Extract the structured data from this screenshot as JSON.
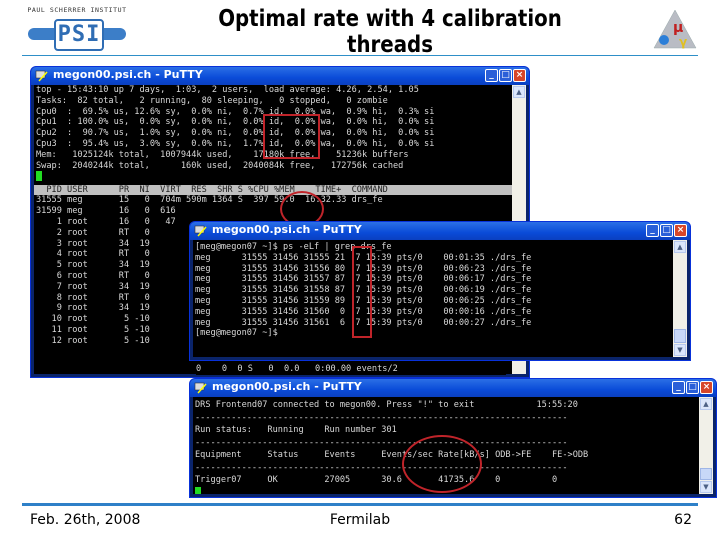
{
  "slide": {
    "title": "Optimal rate with 4 calibration threads",
    "logo_left": {
      "org": "PAUL SCHERRER INSTITUT",
      "mark": "PSI"
    },
    "logo_right": {
      "symbols": [
        "μ",
        "e",
        "γ"
      ]
    },
    "footer": {
      "date": "Feb. 26th, 2008",
      "venue": "Fermilab",
      "page": "62"
    },
    "colors": {
      "rule": "#2e8fc8",
      "highlight": "#c0242a",
      "terminal_bg": "#000000",
      "titlebar": "#0a4bd8",
      "cursor": "#22dd22"
    }
  },
  "windows": [
    {
      "id": "top",
      "title": "megon00.psi.ch - PuTTY",
      "lines": [
        "top - 15:43:10 up 7 days,  1:03,  2 users,  load average: 4.26, 2.54, 1.05",
        "Tasks:  82 total,   2 running,  80 sleeping,   0 stopped,   0 zombie",
        "Cpu0  :  69.5% us, 12.6% sy,  0.0% ni,  0.7% id,  0.0% wa,  0.9% hi,  0.3% si",
        "Cpu1  : 100.0% us,  0.0% sy,  0.0% ni,  0.0% id,  0.0% wa,  0.0% hi,  0.0% si",
        "Cpu2  :  90.7% us,  1.0% sy,  0.0% ni,  0.0% id,  0.0% wa,  0.0% hi,  0.0% si",
        "Cpu3  :  95.4% us,  3.0% sy,  0.0% ni,  1.7% id,  0.0% wa,  0.0% hi,  0.0% si",
        "Mem:   1025124k total,  1007944k used,    17180k free,    51236k buffers",
        "Swap:  2040244k total,      160k used,  2040084k free,   172756k cached"
      ],
      "process_header": "  PID USER      PR  NI  VIRT  RES  SHR S %CPU %MEM    TIME+  COMMAND",
      "processes": [
        "31555 meg       15   0  704m 590m 1364 S  397 59.0  16:32.33 drs_fe",
        "31599 meg       16   0  616",
        "    1 root      16   0   47",
        "    2 root      RT   0",
        "    3 root      34  19",
        "    4 root      RT   0",
        "    5 root      34  19",
        "    6 root      RT   0",
        "    7 root      34  19",
        "    8 root      RT   0",
        "    9 root      34  19",
        "   10 root       5 -10",
        "   11 root       5 -10",
        "   12 root       5 -10"
      ],
      "partial_row_tail": "0    0  0 S   0  0.0   0:00.00 events/2",
      "highlight_note": "%CPU 397"
    },
    {
      "id": "ps",
      "title": "megon00.psi.ch - PuTTY",
      "lines": [
        "[meg@megon07 ~]$ ps -eLf | grep drs_fe",
        "meg      31555 31456 31555 21  7 15:39 pts/0    00:01:35 ./drs_fe",
        "meg      31555 31456 31556 80  7 15:39 pts/0    00:06:23 ./drs_fe",
        "meg      31555 31456 31557 87  7 15:39 pts/0    00:06:17 ./drs_fe",
        "meg      31555 31456 31558 87  7 15:39 pts/0    00:06:19 ./drs_fe",
        "meg      31555 31456 31559 89  7 15:39 pts/0    00:06:25 ./drs_fe",
        "meg      31555 31456 31560  0  7 15:39 pts/0    00:00:16 ./drs_fe",
        "meg      31555 31456 31561  6  7 15:39 pts/0    00:00:27 ./drs_fe",
        "[meg@megon07 ~]$"
      ]
    },
    {
      "id": "frontend",
      "title": "megon00.psi.ch - PuTTY",
      "lines": [
        "DRS Frontend07 connected to megon00. Press \"!\" to exit            15:55:20",
        "------------------------------------------------------------------------",
        "Run status:   Running    Run number 301",
        "------------------------------------------------------------------------",
        "Equipment     Status     Events     Events/sec Rate[kB/s] ODB->FE    FE->ODB",
        "------------------------------------------------------------------------",
        "Trigger07     OK         27005      30.6       41735.6    0          0"
      ]
    }
  ]
}
